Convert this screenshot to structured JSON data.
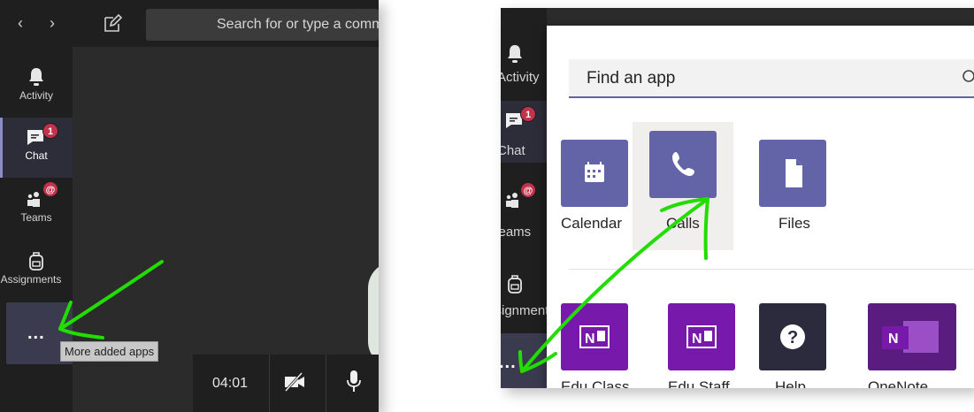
{
  "left": {
    "search_placeholder": "Search for or type a command",
    "rail": [
      {
        "label": "Activity",
        "icon": "bell-icon"
      },
      {
        "label": "Chat",
        "icon": "chat-icon",
        "badge": "1"
      },
      {
        "label": "Teams",
        "icon": "teams-icon",
        "badge": "@"
      },
      {
        "label": "Assignments",
        "icon": "backpack-icon"
      }
    ],
    "more_dots": "...",
    "tooltip": "More added apps",
    "call_time": "04:01"
  },
  "right": {
    "rail": [
      {
        "label": "Activity",
        "icon": "bell-icon"
      },
      {
        "label": "Chat",
        "icon": "chat-icon",
        "badge": "1"
      },
      {
        "label": "Teams",
        "icon": "teams-icon",
        "badge": "@"
      },
      {
        "label": "Assignments",
        "icon": "backpack-icon"
      }
    ],
    "more_dots": "...",
    "find_placeholder": "Find an app",
    "apps_row1": [
      {
        "label": "Calendar",
        "icon": "calendar-icon"
      },
      {
        "label": "Calls",
        "icon": "phone-icon"
      },
      {
        "label": "Files",
        "icon": "file-icon"
      }
    ],
    "apps_row2": [
      {
        "label": "Edu Class",
        "icon": "onenote-icon"
      },
      {
        "label": "Edu Staff",
        "icon": "onenote-icon"
      },
      {
        "label": "Help",
        "icon": "help-icon"
      },
      {
        "label": "OneNote",
        "icon": "onenote-icon"
      }
    ]
  },
  "colors": {
    "teams_purple": "#6264a7",
    "onenote_purple": "#7719aa",
    "badge_red": "#c4314b",
    "annotation_green": "#22dd00",
    "dark_bg": "#2b2b2b",
    "rail_bg": "#1f1f1f"
  }
}
